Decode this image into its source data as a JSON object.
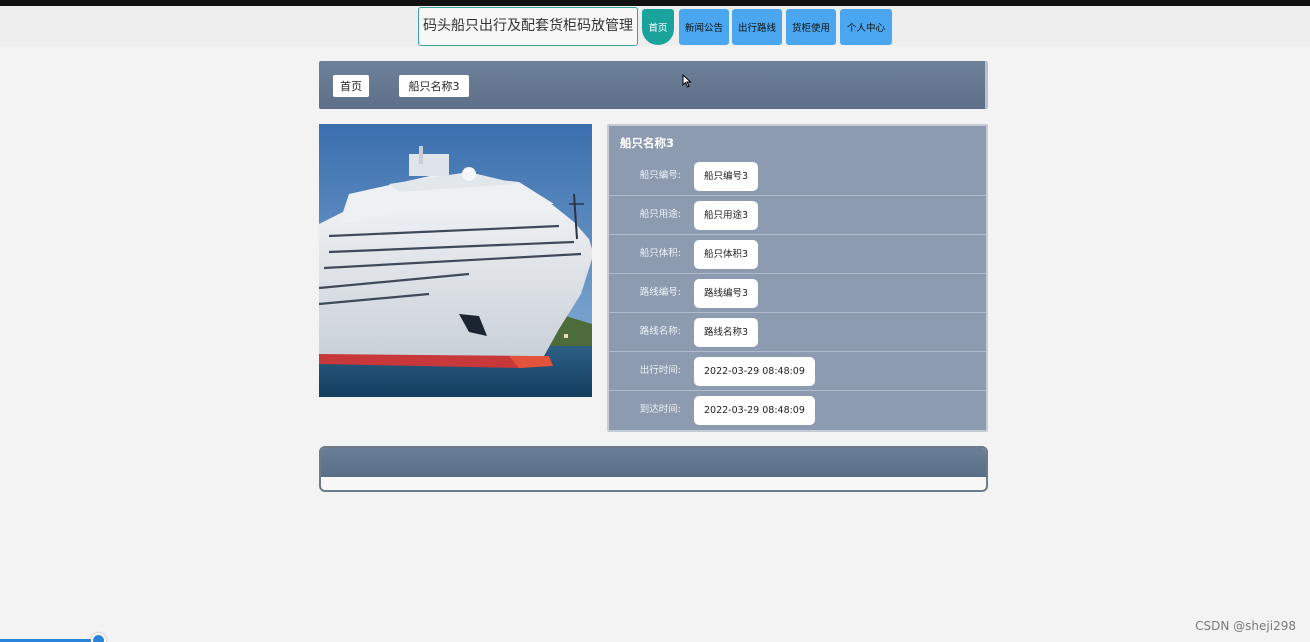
{
  "header": {
    "site_title": "码头船只出行及配套货柜码放管理",
    "nav": [
      "首页",
      "新闻公告",
      "出行路线",
      "货柜使用",
      "个人中心"
    ]
  },
  "breadcrumb": {
    "home": "首页",
    "current": "船只名称3"
  },
  "detail": {
    "title": "船只名称3",
    "rows": [
      {
        "label": "船只编号:",
        "value": "船只编号3"
      },
      {
        "label": "船只用途:",
        "value": "船只用途3"
      },
      {
        "label": "船只体积:",
        "value": "船只体积3"
      },
      {
        "label": "路线编号:",
        "value": "路线编号3"
      },
      {
        "label": "路线名称:",
        "value": "路线名称3"
      },
      {
        "label": "出行时间:",
        "value": "2022-03-29 08:48:09"
      },
      {
        "label": "到达时间:",
        "value": "2022-03-29 08:48:09"
      }
    ]
  },
  "watermark": "CSDN @sheji298",
  "colors": {
    "accent": "#1aa39c",
    "nav_blue": "#4aa7ef",
    "panel": "#8c9bb0"
  }
}
